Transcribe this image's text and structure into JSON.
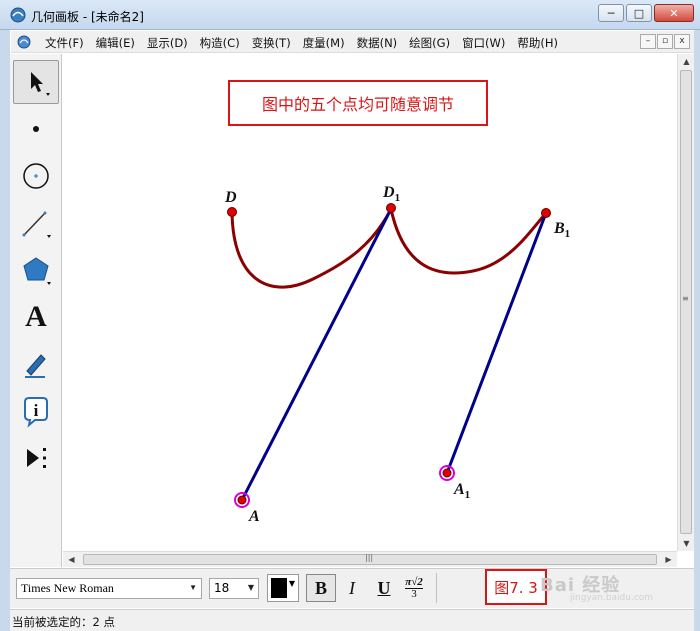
{
  "window": {
    "title": "几何画板 - [未命名2]",
    "minimize": "─",
    "maximize": "□",
    "close": "✕"
  },
  "menu": {
    "items": [
      "文件(F)",
      "编辑(E)",
      "显示(D)",
      "构造(C)",
      "变换(T)",
      "度量(M)",
      "数据(N)",
      "绘图(G)",
      "窗口(W)",
      "帮助(H)"
    ],
    "mdi": {
      "minimize": "–",
      "restore": "▫",
      "close": "x"
    }
  },
  "toolbar": {
    "tools": [
      "arrow-tool",
      "point-tool",
      "compass-tool",
      "straightedge-tool",
      "polygon-tool",
      "text-tool",
      "marker-tool",
      "information-tool",
      "custom-tool"
    ],
    "text_tool_glyph": "A",
    "info_glyph": "i"
  },
  "canvas": {
    "note": "图中的五个点均可随意调节",
    "points": {
      "D": {
        "label": "D",
        "sub": ""
      },
      "D1": {
        "label": "D",
        "sub": "1"
      },
      "B1": {
        "label": "B",
        "sub": "1"
      },
      "A": {
        "label": "A",
        "sub": ""
      },
      "A1": {
        "label": "A",
        "sub": "1"
      }
    },
    "colors": {
      "curve": "#8b0000",
      "segment": "#00008b",
      "point": "#e00000",
      "selected_ring": "#d800d8"
    }
  },
  "formatbar": {
    "font": "Times New Roman",
    "size": "18",
    "bold": "B",
    "italic": "I",
    "underline": "U",
    "math_top": "π√2",
    "math_bottom": "3",
    "figure_label": "图7. 3",
    "watermark": "Bai 经验",
    "watermark_sub": "jingyan.baidu.com"
  },
  "status": {
    "text": "当前被选定的：2 点"
  }
}
